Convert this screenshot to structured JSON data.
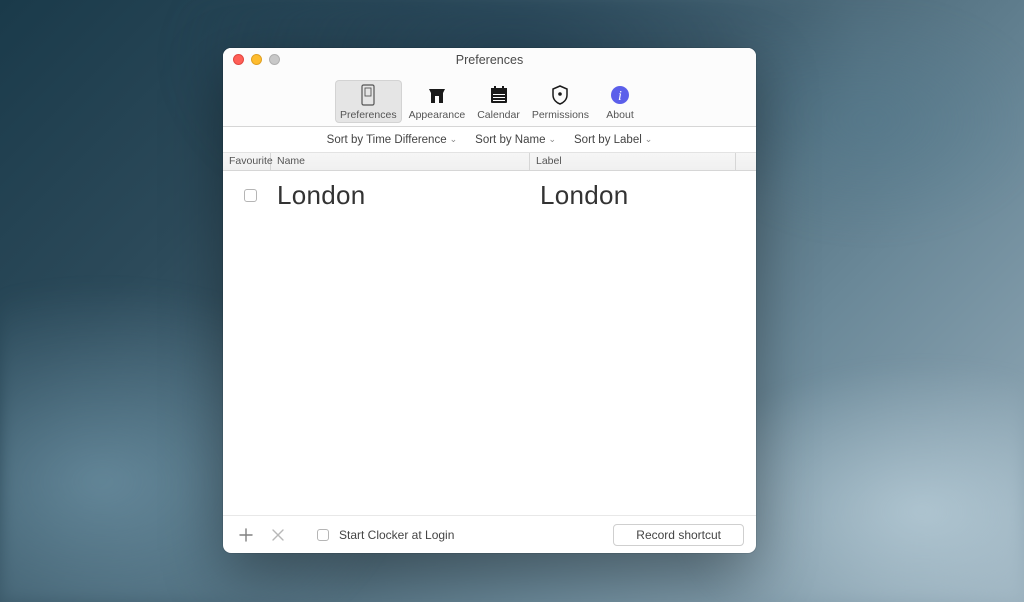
{
  "window": {
    "title": "Preferences"
  },
  "toolbar": {
    "tabs": [
      {
        "id": "preferences",
        "label": "Preferences"
      },
      {
        "id": "appearance",
        "label": "Appearance"
      },
      {
        "id": "calendar",
        "label": "Calendar"
      },
      {
        "id": "permissions",
        "label": "Permissions"
      },
      {
        "id": "about",
        "label": "About"
      }
    ],
    "active": "preferences"
  },
  "sort": {
    "timediff": "Sort by Time Difference",
    "name": "Sort by Name",
    "label": "Sort by Label"
  },
  "columns": {
    "favourite": "Favourite",
    "name": "Name",
    "label": "Label"
  },
  "rows": [
    {
      "favourite": false,
      "name": "London",
      "label": "London"
    }
  ],
  "footer": {
    "login_label": "Start Clocker at Login",
    "record_label": "Record shortcut"
  }
}
